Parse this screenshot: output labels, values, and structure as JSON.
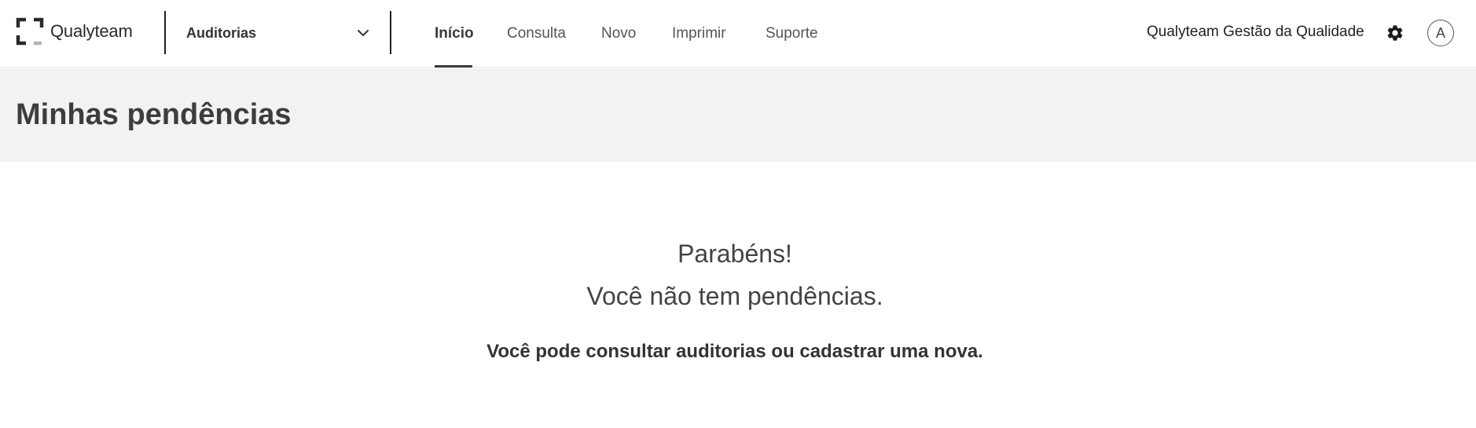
{
  "app": {
    "logo_text": "Qualyteam",
    "module": "Auditorias",
    "org_name": "Qualyteam Gestão da Qualidade",
    "avatar_initial": "A"
  },
  "nav": {
    "items": [
      {
        "label": "Início",
        "active": true
      },
      {
        "label": "Consulta",
        "active": false
      },
      {
        "label": "Novo",
        "active": false
      },
      {
        "label": "Imprimir",
        "active": false
      },
      {
        "label": "Suporte",
        "active": false
      }
    ]
  },
  "page": {
    "title": "Minhas pendências"
  },
  "empty_state": {
    "line1": "Parabéns!",
    "line2": "Você não tem pendências.",
    "hint": "Você pode consultar auditorias ou cadastrar uma nova."
  },
  "colors": {
    "text": "#3d3d3d",
    "header_bg": "#f2f2f2",
    "logo_gray": "#b5b5b5"
  },
  "icons": {
    "logo": "qualyteam-logo-icon",
    "module_dropdown": "chevron-down-icon",
    "settings": "gear-icon"
  }
}
